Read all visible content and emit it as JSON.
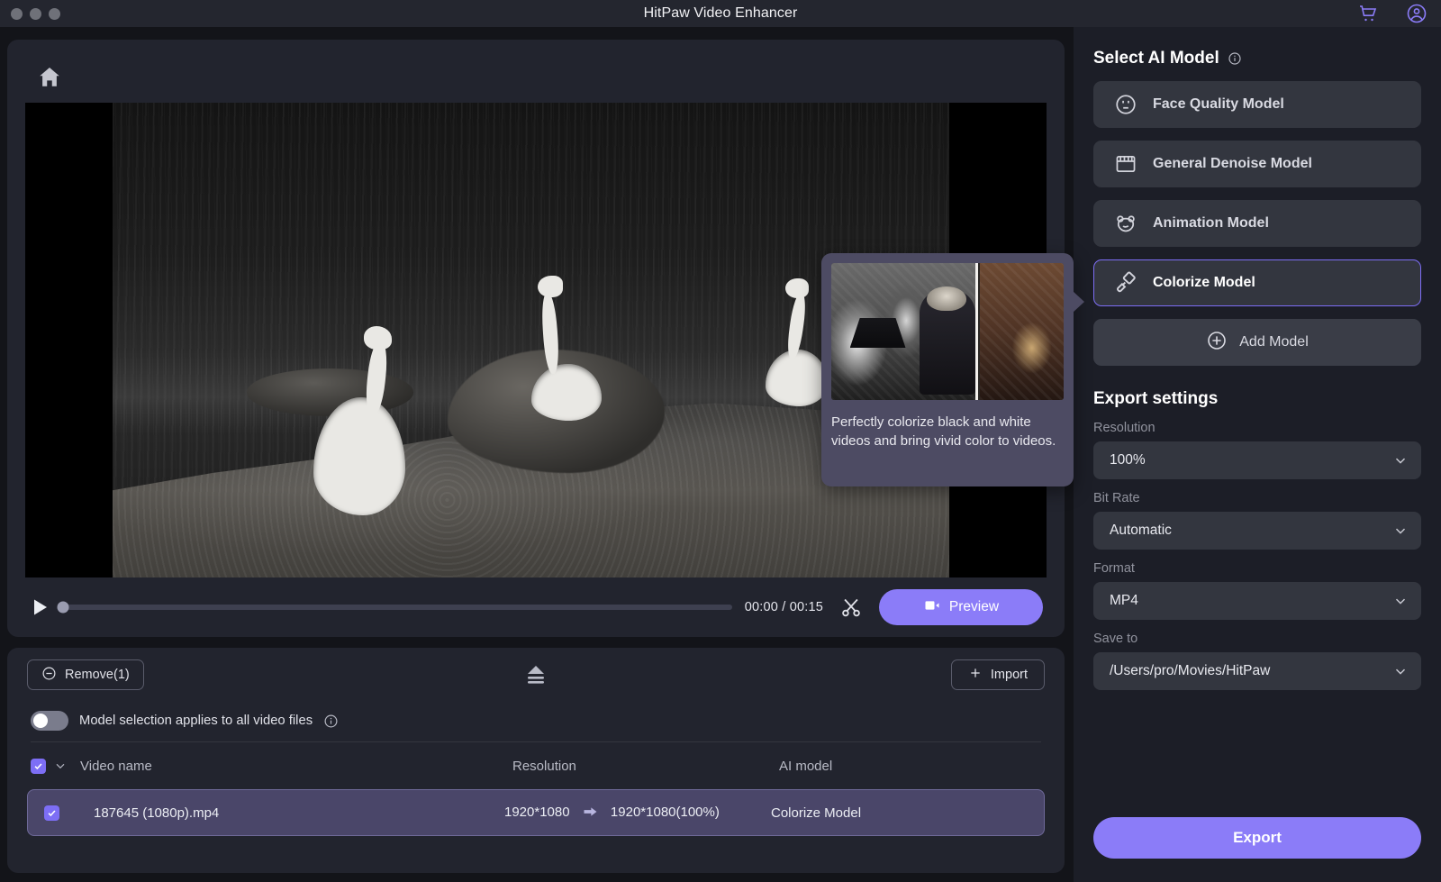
{
  "window": {
    "title": "HitPaw Video Enhancer",
    "traffic_lights": [
      "close",
      "minimize",
      "zoom"
    ],
    "cart_icon": "shopping-cart-icon",
    "account_icon": "user-account-icon"
  },
  "player": {
    "home_icon": "home-icon",
    "play_icon": "play-icon",
    "current_time": "00:00",
    "total_time": "00:15",
    "time_display": "00:00 / 00:15",
    "progress_percent": 0,
    "trim_icon": "scissors-icon",
    "preview_label": "Preview",
    "preview_icon": "video-camera-icon"
  },
  "file_panel": {
    "remove_label": "Remove(1)",
    "remove_icon": "minus-circle-icon",
    "eject_icon": "collapse-panel-icon",
    "import_label": "Import",
    "import_icon": "plus-icon",
    "apply_all_label": "Model selection applies to all video files",
    "apply_all_enabled": false,
    "apply_all_info_icon": "info-icon",
    "columns": [
      "Video name",
      "Resolution",
      "AI model"
    ],
    "rows": [
      {
        "checked": true,
        "name": "187645 (1080p).mp4",
        "resolution_from": "1920*1080",
        "resolution_arrow": "arrow-right-icon",
        "resolution_to": "1920*1080(100%)",
        "ai_model": "Colorize Model"
      }
    ],
    "header_checked": true,
    "header_chevron_icon": "chevron-down-icon"
  },
  "sidebar": {
    "select_model_title": "Select AI Model",
    "select_model_info_icon": "info-icon",
    "models": [
      {
        "label": "Face Quality Model",
        "icon": "face-icon",
        "selected": false
      },
      {
        "label": "General Denoise Model",
        "icon": "clapperboard-icon",
        "selected": false
      },
      {
        "label": "Animation Model",
        "icon": "bear-face-icon",
        "selected": false
      },
      {
        "label": "Colorize Model",
        "icon": "paint-roller-icon",
        "selected": true
      }
    ],
    "add_model_label": "Add Model",
    "add_model_icon": "plus-circle-icon",
    "export_settings_title": "Export settings",
    "fields": [
      {
        "label": "Resolution",
        "value": "100%",
        "chevron": "chevron-down-icon"
      },
      {
        "label": "Bit Rate",
        "value": "Automatic",
        "chevron": "chevron-down-icon"
      },
      {
        "label": "Format",
        "value": "MP4",
        "chevron": "chevron-down-icon"
      },
      {
        "label": "Save to",
        "value": "/Users/pro/Movies/HitPaw",
        "chevron": "chevron-down-icon"
      }
    ],
    "export_label": "Export"
  },
  "tooltip": {
    "text": "Perfectly colorize black and white videos and bring vivid color to videos.",
    "thumbnail_alt": "before-after-colorize-preview"
  },
  "colors": {
    "accent": "#8b7cf8",
    "accent_border": "#7d6ef5",
    "page_bg": "#131419",
    "card_bg": "#22242e",
    "panel_bg": "#1c1e27",
    "control_bg": "#33363f",
    "row_selected": "#4a4669",
    "tooltip_bg": "#4d4b63"
  }
}
